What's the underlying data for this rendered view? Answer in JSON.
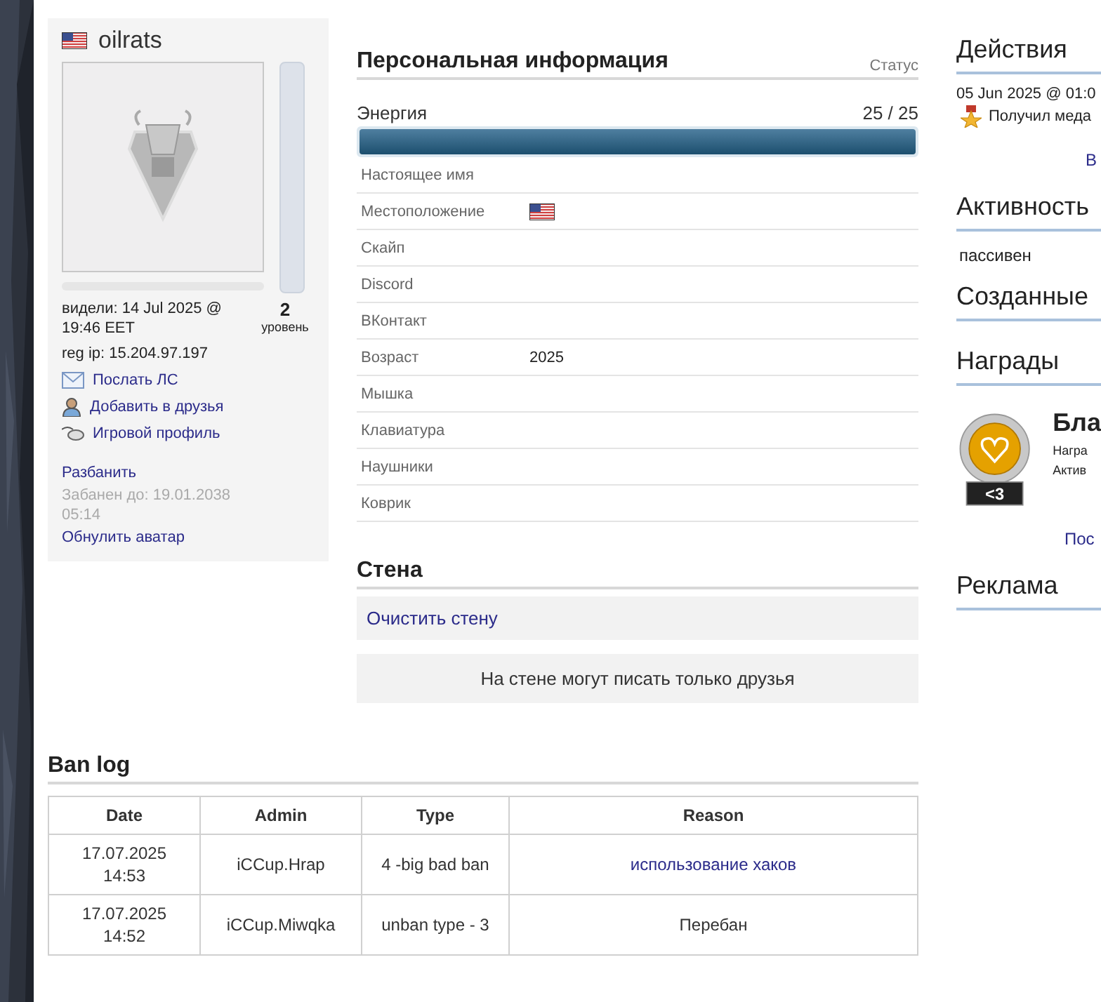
{
  "profile": {
    "name": "oilrats",
    "experience": {
      "level": 0
    },
    "level_value": "2",
    "level_label": "уровень",
    "last_seen": "видели: 14 Jul 2025 @ 19:46 EET",
    "reg_ip": "reg ip: 15.204.97.197",
    "links": [
      {
        "kind": "mail",
        "label": "Послать ЛС"
      },
      {
        "kind": "friend",
        "label": "Добавить в друзья"
      },
      {
        "kind": "mouse",
        "label": "Игровой профиль"
      }
    ],
    "unban": "Разбанить",
    "banned_until": "Забанен до: 19.01.2038 05:14",
    "reset_avatar": "Обнулить аватар"
  },
  "personal": {
    "title": "Персональная информация",
    "status": "Статус",
    "energy": {
      "label": "Энергия",
      "reading": "25 / 25",
      "level": 1
    },
    "fields": [
      {
        "label": "Настоящее имя",
        "kind": "text"
      },
      {
        "label": "Местоположение",
        "kind": "flag"
      },
      {
        "label": "Скайп",
        "kind": "text"
      },
      {
        "label": "Discord",
        "kind": "text"
      },
      {
        "label": "ВКонтакт",
        "kind": "text"
      },
      {
        "label": "Возраст",
        "kind": "text",
        "value": "2025"
      },
      {
        "label": "Мышка",
        "kind": "text"
      },
      {
        "label": "Клавиатура",
        "kind": "text"
      },
      {
        "label": "Наушники",
        "kind": "text"
      },
      {
        "label": "Коврик",
        "kind": "text"
      }
    ]
  },
  "wall": {
    "title": "Стена",
    "clear": "Очистить стену",
    "notice": "На стене могут писать только друзья"
  },
  "ban_log": {
    "title": "Ban log",
    "columns": [
      "Date",
      "Admin",
      "Type",
      "Reason"
    ],
    "rows": [
      {
        "date": "17.07.2025\n14:53",
        "admin": "iCCup.Hrap",
        "type": "4 -big bad ban",
        "reason": "использование хаков",
        "reason_link": true
      },
      {
        "date": "17.07.2025\n14:52",
        "admin": "iCCup.Miwqka",
        "type": "unban type - 3",
        "reason": "Перебан",
        "reason_link": false
      }
    ]
  },
  "sidebar": {
    "actions": {
      "title": "Действия",
      "time": "05 Jun 2025 @ 01:0",
      "event": "Получил меда",
      "more": "В"
    },
    "activity": {
      "title": "Активность",
      "value": "пассивен"
    },
    "created": {
      "title": "Созданные"
    },
    "awards": {
      "title": "Награды",
      "badge": "<3",
      "name": "Бла",
      "line_1": "Награ",
      "line_2": "Актив",
      "more": "Пос"
    },
    "ads": {
      "title": "Реклама"
    }
  }
}
